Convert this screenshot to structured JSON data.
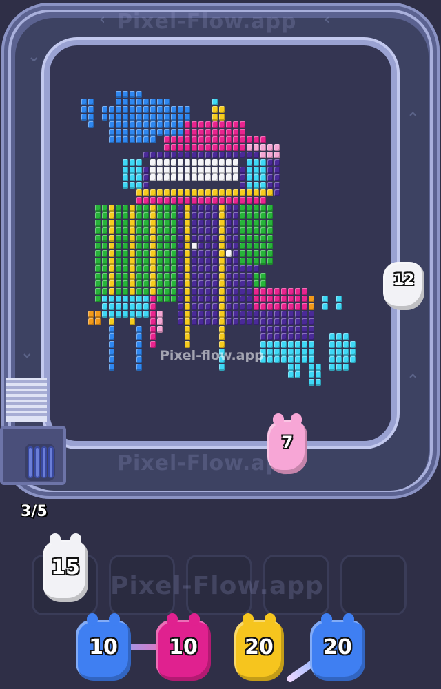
{
  "watermark": {
    "text": "Pixel-Flow.app",
    "center": "Pixel-flow.app"
  },
  "conveyor": {
    "slots_used": "3/5"
  },
  "track_shooters": [
    {
      "value": "12",
      "color": "#f2f2f6"
    },
    {
      "value": "7",
      "color": "#f7a6d6"
    }
  ],
  "queue_slots": [
    {
      "filled": true,
      "value": "15",
      "color": "#f2f2f6"
    },
    {
      "filled": false
    },
    {
      "filled": false
    },
    {
      "filled": false
    },
    {
      "filled": false
    }
  ],
  "bottom_shooters": [
    {
      "value": "10",
      "color": "#3f7ff2"
    },
    {
      "value": "10",
      "color": "#e0218f"
    },
    {
      "value": "20",
      "color": "#f6c51e"
    },
    {
      "value": "20",
      "color": "#3f7ff2"
    }
  ],
  "palette": {
    "blue": "#2f87f0",
    "cyan": "#3fd8f6",
    "pink": "#e9248f",
    "lightpink": "#f5a6d4",
    "green": "#27b43a",
    "yellow": "#f6cc1f",
    "purple": "#4a2a98",
    "white": "#f4f4f8",
    "orange": "#f39a1a"
  }
}
